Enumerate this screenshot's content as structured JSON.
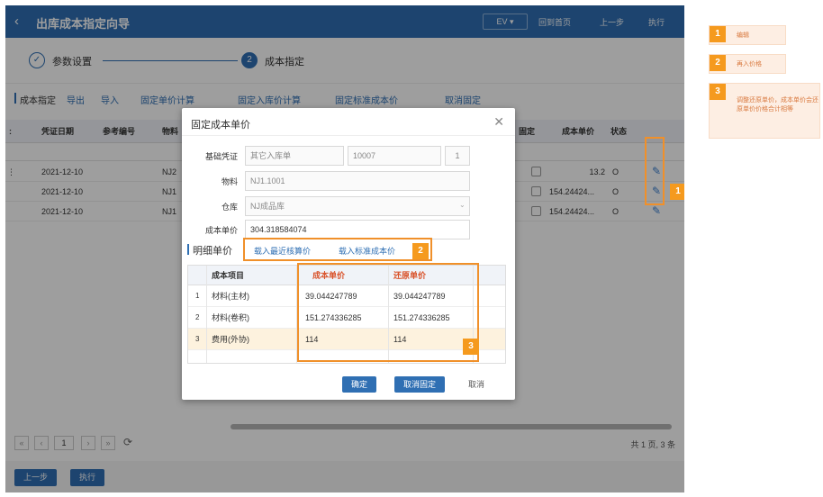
{
  "window": {
    "back_glyph": "‹",
    "title": "出库成本指定向导",
    "ev_label": "EV ▾",
    "home_label": "回到首页",
    "prev_label": "上一步",
    "run_label": "执行"
  },
  "steps": [
    {
      "label": "参数设置",
      "icon": "check-icon",
      "marker": "✓"
    },
    {
      "label": "成本指定",
      "marker": "2"
    }
  ],
  "tabs": {
    "title": "成本指定",
    "items": [
      "导出",
      "导入",
      "固定单价计算",
      "固定入库价计算",
      "固定标准成本价",
      "取消固定"
    ]
  },
  "grid": {
    "headers": [
      "凭证日期",
      "参考编号",
      "物料",
      "固定",
      "成本单价",
      "状态"
    ],
    "first_col_stub": ":",
    "rows": [
      {
        "stub": "⋮",
        "date": "2021-12-10",
        "material": "NJ2",
        "price": "13.2",
        "status": "O"
      },
      {
        "stub": "",
        "date": "2021-12-10",
        "material": "NJ1",
        "price": "154.24424...",
        "status": "O"
      },
      {
        "stub": "",
        "date": "2021-12-10",
        "material": "NJ1",
        "price": "154.24424...",
        "status": "O"
      }
    ]
  },
  "pager": {
    "first": "«",
    "prev": "‹",
    "page": "1",
    "next": "›",
    "last": "»",
    "refresh": "⟳",
    "total": "共 1 页, 3 条"
  },
  "bottom": {
    "prev_label": "上一步",
    "run_label": "执行"
  },
  "dialog": {
    "title": "固定成本单价",
    "close": "✕",
    "fields": {
      "voucher_label": "基础凭证",
      "voucher_type": "其它入库单",
      "voucher_no": "10007",
      "voucher_line": "1",
      "material_label": "物料",
      "material_value": "NJ1.1001",
      "warehouse_label": "仓库",
      "warehouse_value": "NJ成品库",
      "unit_cost_label": "成本单价",
      "unit_cost_value": "304.318584074"
    },
    "detail_title": "明细单价",
    "link_recent": "载入最近核算价",
    "link_standard": "载入标准成本价",
    "detail_headers": [
      "成本项目",
      "成本单价",
      "还原单价"
    ],
    "detail_rows": [
      {
        "idx": "1",
        "item": "材料(主材)",
        "cost": "39.044247789",
        "restore": "39.044247789"
      },
      {
        "idx": "2",
        "item": "材料(卷积)",
        "cost": "151.274336285",
        "restore": "151.274336285"
      },
      {
        "idx": "3",
        "item": "费用(外协)",
        "cost": "114",
        "restore": "114"
      }
    ],
    "confirm_label": "确定",
    "unfix_label": "取消固定",
    "cancel_label": "取消"
  },
  "annotations": [
    {
      "num": "1",
      "text": "编辑"
    },
    {
      "num": "2",
      "text": "再入价格"
    },
    {
      "num": "3",
      "text": "调整还原单价，成本单价会还原单价价格合计相等"
    }
  ],
  "colors": {
    "brand": "#2f6fb3",
    "accent": "#f59a1e",
    "annotation_bg": "#fdeee3"
  }
}
